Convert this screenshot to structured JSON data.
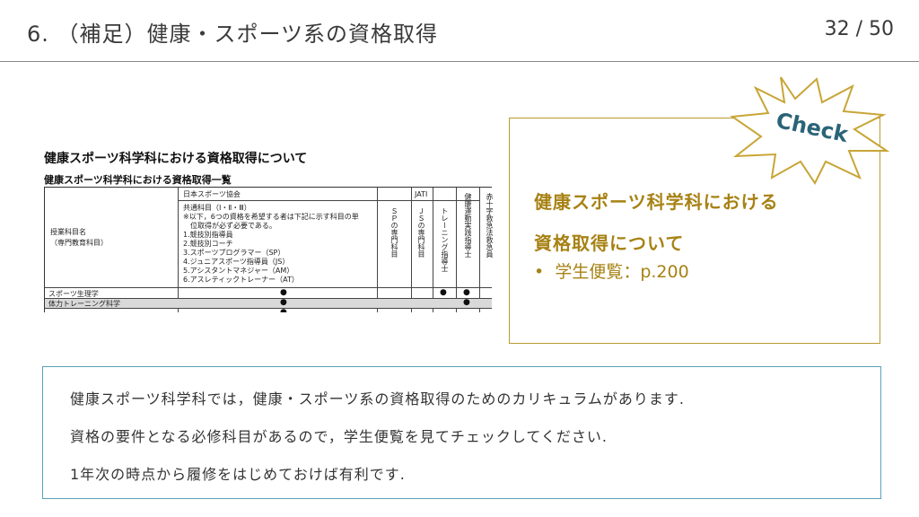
{
  "header": {
    "title": "6. （補足）健康・スポーツ系の資格取得",
    "page": "32 / 50"
  },
  "doc_image": {
    "heading": "健康スポーツ科学科における資格取得について",
    "subheading": "健康スポーツ科学科における資格取得一覧",
    "row_label_title": "授業科目名",
    "row_label_sub": "（専門教育科目）",
    "org_jsa": "日本スポーツ協会",
    "org_jati": "JATI",
    "common_subjects": "共通科目（Ⅰ・Ⅱ・Ⅲ）",
    "note_line1": "※以下，6つの資格を希望する者は下記に示す科目の単",
    "note_line2": "位取得が必ず必要である。",
    "items": [
      "1.競技別指導員",
      "2.競技別コーチ",
      "3.スポーツプログラマー（SP）",
      "4.ジュニアスポーツ指導員（JS）",
      "5.アシスタントマネジャー（AM）",
      "6.アスレティックトレーナー（AT）"
    ],
    "col_sp": "ＳＰの専門科目",
    "col_js": "ＪＳの専門科目",
    "col_training": "トレーニング指導士",
    "col_health": "健康運動実践指導士",
    "col_redcross": "赤十字救急法救急員",
    "rows": [
      "スポーツ生理学",
      "体力トレーニング科学",
      "…"
    ],
    "mark": "●"
  },
  "info_box": {
    "title_line1": "健康スポーツ科学科における",
    "title_line2": "資格取得について",
    "bullet": "•",
    "bullet_text": "学生便覧：p.200"
  },
  "badge": {
    "label": "Check",
    "fill": "#ffffff",
    "stroke": "#c8a536",
    "text_color": "#2a6478"
  },
  "note": {
    "line1": "健康スポーツ科学科では，健康・スポーツ系の資格取得のためのカリキュラムがあります.",
    "line2": "資格の要件となる必修科目があるので，学生便覧を見てチェックしてください.",
    "line3": "1年次の時点から履修をはじめておけば有利です."
  }
}
